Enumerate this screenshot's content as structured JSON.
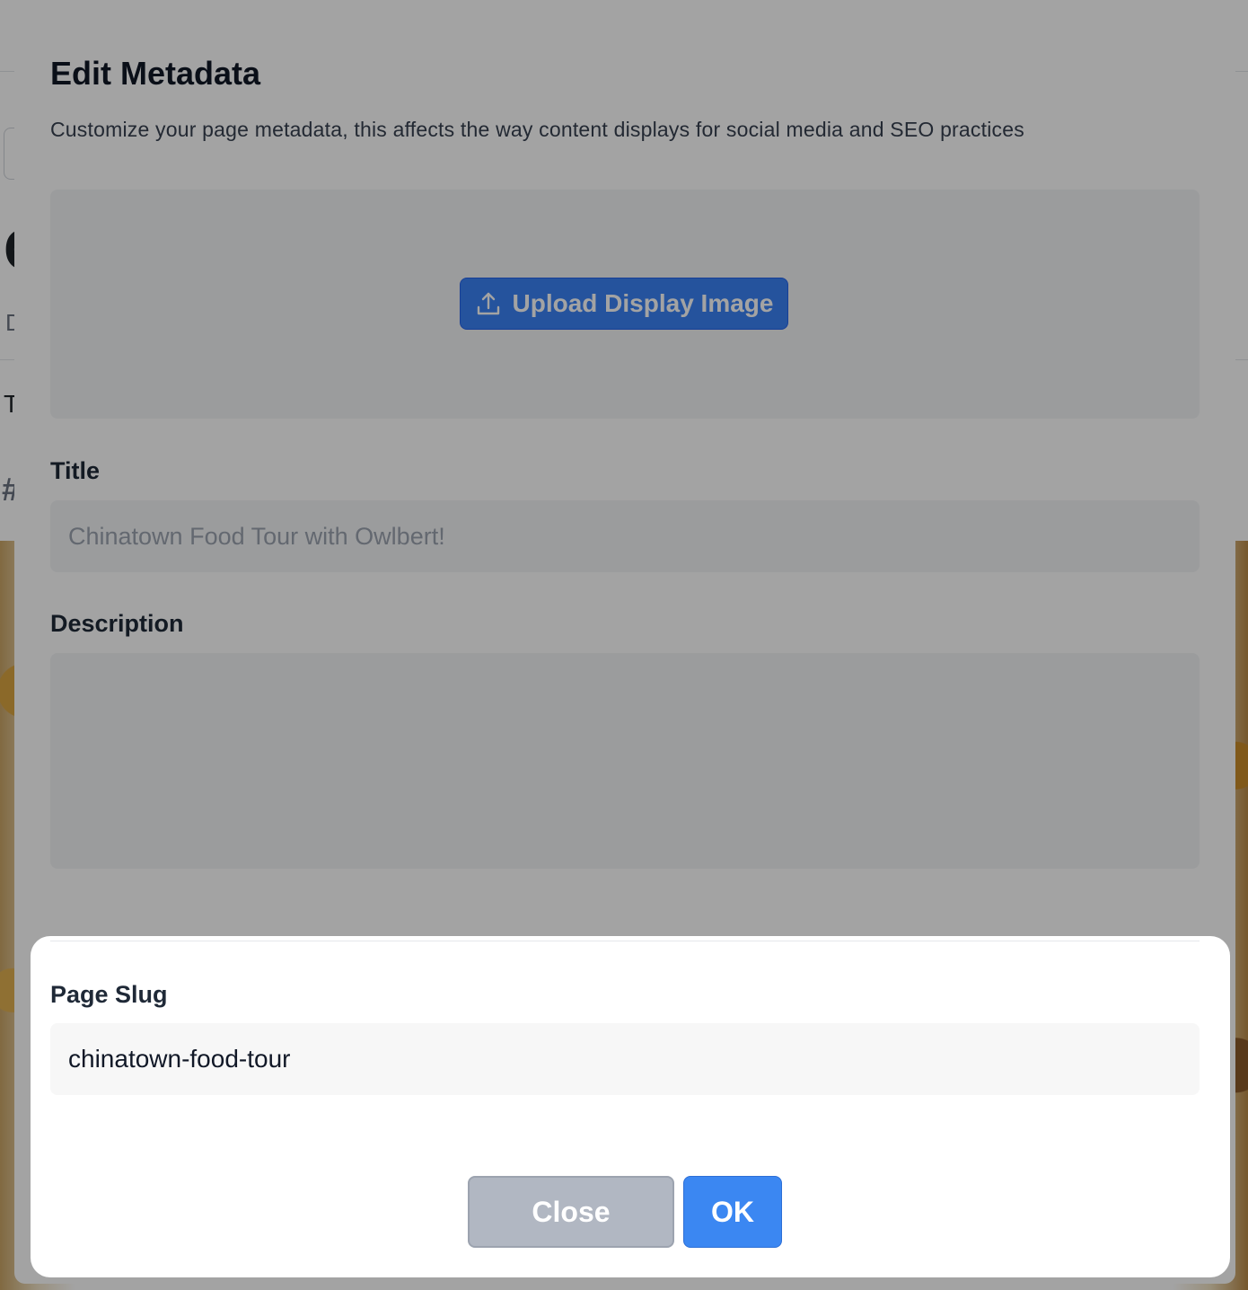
{
  "background": {
    "heading_fragment": "C",
    "sub_fragment": "D",
    "text_fragment": "T",
    "hash_fragment": "#"
  },
  "modal": {
    "title": "Edit Metadata",
    "description": "Customize your page metadata, this affects the way content displays for social media and SEO practices",
    "upload_button_label": "Upload Display Image",
    "title_label": "Title",
    "title_placeholder": "Chinatown Food Tour with Owlbert!",
    "description_label": "Description",
    "description_value": "",
    "slug_label": "Page Slug",
    "slug_value": "chinatown-food-tour",
    "close_label": "Close",
    "ok_label": "OK"
  },
  "colors": {
    "primary": "#3b87f2",
    "secondary": "#b1b7c2",
    "overlay": "rgba(0,0,0,0.36)"
  },
  "icons": {
    "upload": "upload-icon"
  }
}
